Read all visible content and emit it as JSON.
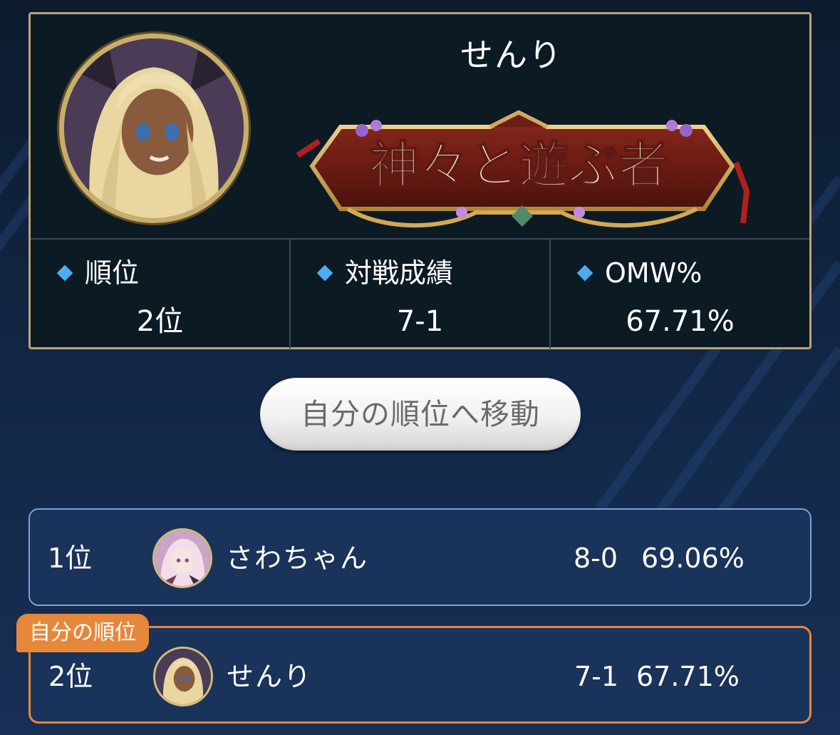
{
  "profile": {
    "name": "せんり",
    "title_emblem_text": "神々と遊ぶ者",
    "avatar_icon": "player-avatar-icon"
  },
  "stats": [
    {
      "label": "順位",
      "value": "2位"
    },
    {
      "label": "対戦成績",
      "value": "7-1"
    },
    {
      "label": "OMW%",
      "value": "67.71%"
    }
  ],
  "move_button_label": "自分の順位へ移動",
  "rankings": [
    {
      "rank": "1位",
      "name": "さわちゃん",
      "record": "8-0",
      "omw": "69.06%"
    },
    {
      "rank": "2位",
      "name": "せんり",
      "record": "7-1",
      "omw": "67.71%",
      "badge": "自分の順位"
    }
  ],
  "colors": {
    "card_border": "#b9a47a",
    "accent_diamond": "#4aaeef",
    "my_rank_highlight": "#e7873a",
    "row_border": "#7fa3d4"
  }
}
